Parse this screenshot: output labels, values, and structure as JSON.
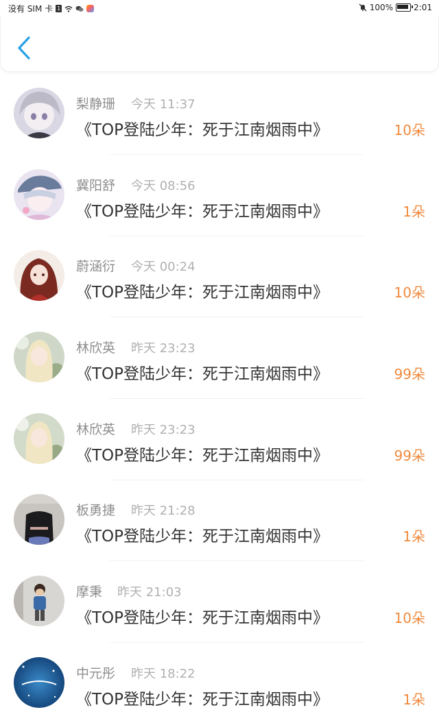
{
  "status_bar": {
    "carrier": "没有 SIM 卡",
    "sim_badge": "1",
    "battery": "100%",
    "time": "2:01"
  },
  "header": {
    "back_icon": "chevron-left-icon"
  },
  "colors": {
    "accent": "#2aa0e6",
    "count": "#f08a3e",
    "name": "#8e8e8e",
    "time": "#b0b0b0"
  },
  "records": [
    {
      "name": "梨静珊",
      "time": "今天 11:37",
      "book": "《TOP登陆少年：死于江南烟雨中》",
      "count": "10朵"
    },
    {
      "name": "冀阳舒",
      "time": "今天 08:56",
      "book": "《TOP登陆少年：死于江南烟雨中》",
      "count": "1朵"
    },
    {
      "name": "蔚涵衍",
      "time": "今天 00:24",
      "book": "《TOP登陆少年：死于江南烟雨中》",
      "count": "10朵"
    },
    {
      "name": "林欣英",
      "time": "昨天 23:23",
      "book": "《TOP登陆少年：死于江南烟雨中》",
      "count": "99朵"
    },
    {
      "name": "林欣英",
      "time": "昨天 23:23",
      "book": "《TOP登陆少年：死于江南烟雨中》",
      "count": "99朵"
    },
    {
      "name": "板勇捷",
      "time": "昨天 21:28",
      "book": "《TOP登陆少年：死于江南烟雨中》",
      "count": "1朵"
    },
    {
      "name": "摩秉",
      "time": "昨天 21:03",
      "book": "《TOP登陆少年：死于江南烟雨中》",
      "count": "10朵"
    },
    {
      "name": "中元彤",
      "time": "昨天 18:22",
      "book": "《TOP登陆少年：死于江南烟雨中》",
      "count": "1朵"
    }
  ]
}
